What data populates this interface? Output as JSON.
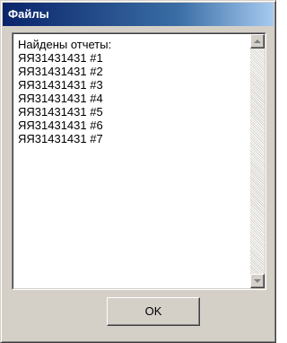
{
  "window": {
    "title": "Файлы",
    "titlebar_colors": [
      "#0a246a",
      "#a6caf0"
    ]
  },
  "report_list": {
    "lines": [
      "Найдены отчеты:",
      "ЯЯ31431431 #1",
      "ЯЯ31431431 #2",
      "ЯЯ31431431 #3",
      "ЯЯ31431431 #4",
      "ЯЯ31431431 #5",
      "ЯЯ31431431 #6",
      "ЯЯ31431431 #7"
    ]
  },
  "scrollbar": {
    "up_icon": "arrow-up-icon",
    "down_icon": "arrow-down-icon",
    "enabled": false
  },
  "buttons": {
    "ok_label": "OK"
  }
}
